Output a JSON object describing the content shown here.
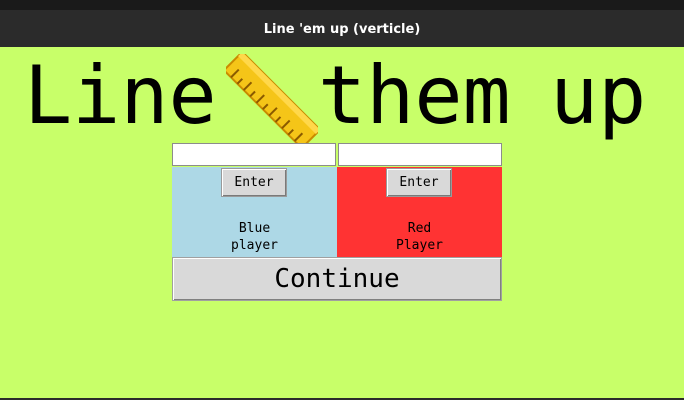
{
  "window": {
    "title": "Line 'em up (verticle)"
  },
  "headline": {
    "word1": "Line",
    "icon": "ruler-icon",
    "word2": "them",
    "word3": "up"
  },
  "players": {
    "blue": {
      "name_value": "",
      "enter_label": "Enter",
      "label_line1": "Blue",
      "label_line2": "player",
      "color": "#add8e6"
    },
    "red": {
      "name_value": "",
      "enter_label": "Enter",
      "label_line1": "Red",
      "label_line2": "Player",
      "color": "#ff3333"
    }
  },
  "continue_label": "Continue",
  "colors": {
    "background": "#c8ff69",
    "titlebar": "#2b2b2b",
    "button": "#d9d9d9"
  }
}
